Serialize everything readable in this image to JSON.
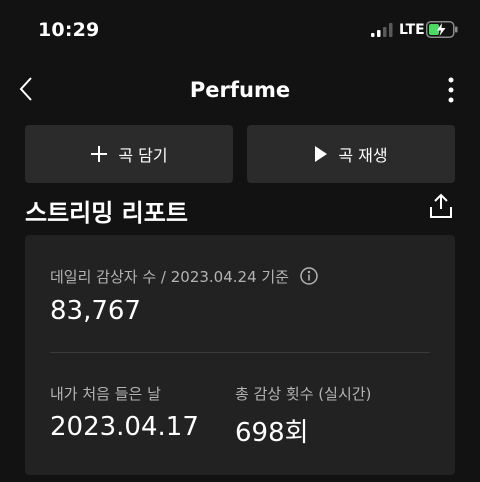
{
  "status_bar": {
    "time": "10:29",
    "network": "LTE"
  },
  "header": {
    "title": "Perfume"
  },
  "actions": {
    "add_label": "곡 담기",
    "play_label": "곡 재생"
  },
  "report": {
    "title": "스트리밍 리포트",
    "daily_listeners_label": "데일리 감상자 수 / 2023.04.24 기준",
    "daily_listeners_value": "83,767",
    "first_listen_label": "내가 처음 들은 날",
    "first_listen_value": "2023.04.17",
    "total_plays_label": "총 감상 횟수 (실시간)",
    "total_plays_value": "698회"
  },
  "colors": {
    "background": "#121212",
    "button": "#2b2b2b",
    "card": "#222222",
    "battery_charging": "#4cd964"
  }
}
